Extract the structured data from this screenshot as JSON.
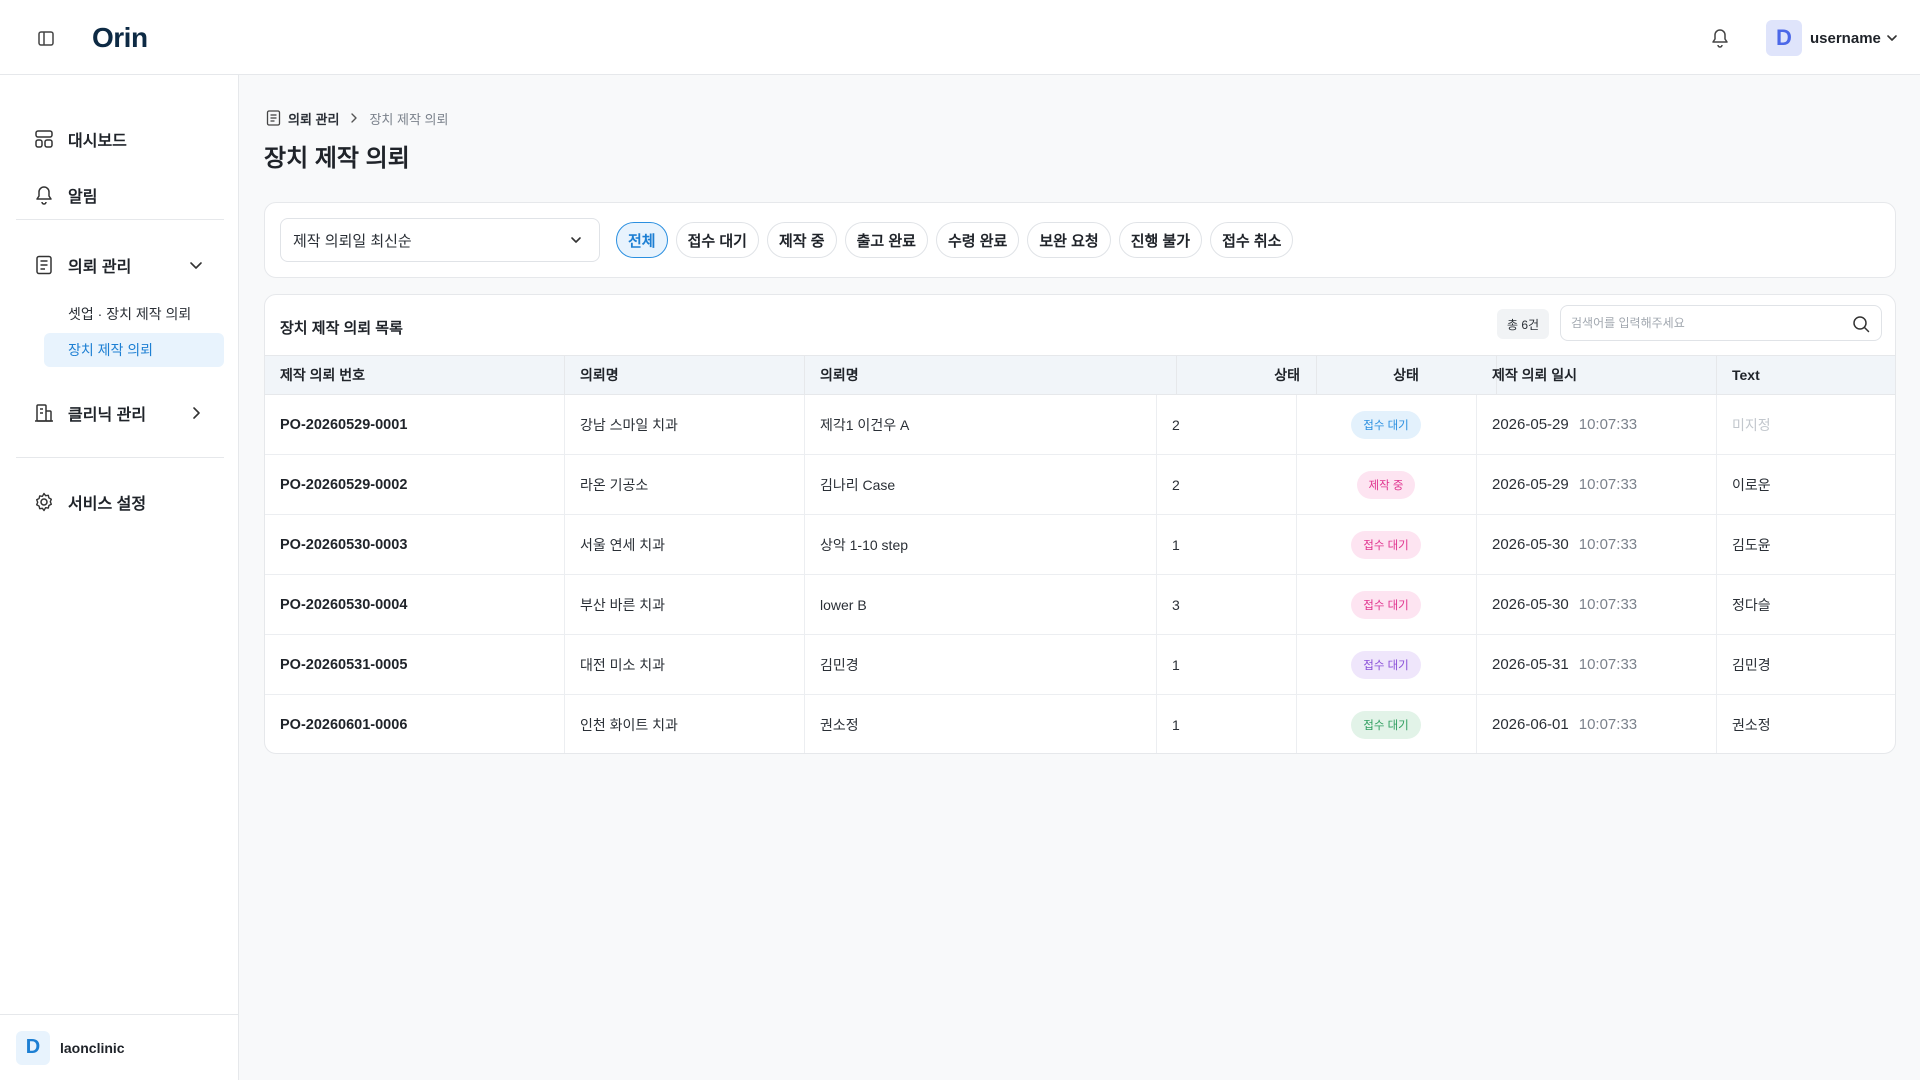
{
  "header": {
    "logo": "Orin",
    "username": "username",
    "avatar_letter": "D"
  },
  "sidebar": {
    "items": [
      {
        "label": "대시보드",
        "icon": "dashboard-icon"
      },
      {
        "label": "알림",
        "icon": "bell-icon"
      },
      {
        "label": "의뢰 관리",
        "icon": "document-list-icon",
        "expanded": true
      },
      {
        "label": "클리닉 관리",
        "icon": "building-icon"
      },
      {
        "label": "서비스 설정",
        "icon": "gear-icon"
      }
    ],
    "sub_items": [
      {
        "label": "셋업 · 장치 제작 의뢰",
        "active": false
      },
      {
        "label": "장치 제작 의뢰",
        "active": true
      }
    ],
    "footer": {
      "avatar_letter": "D",
      "org_name": "laonclinic"
    }
  },
  "breadcrumb": {
    "parent": "의뢰 관리",
    "current": "장치 제작 의뢰"
  },
  "page_title": "장치 제작 의뢰",
  "filters": {
    "sort_value": "제작 의뢰일 최신순",
    "chips": [
      {
        "label": "전체",
        "active": true
      },
      {
        "label": "접수 대기",
        "active": false
      },
      {
        "label": "제작 중",
        "active": false
      },
      {
        "label": "출고 완료",
        "active": false
      },
      {
        "label": "수령 완료",
        "active": false
      },
      {
        "label": "보완 요청",
        "active": false
      },
      {
        "label": "진행 불가",
        "active": false
      },
      {
        "label": "접수 취소",
        "active": false
      }
    ]
  },
  "table": {
    "title": "장치 제작 의뢰 목록",
    "total": "총 6건",
    "search_placeholder": "검색어를 입력해주세요",
    "columns": [
      "제작 의뢰 번호",
      "의뢰명",
      "의뢰명",
      "상태",
      "상태",
      "제작 의뢰 일시",
      "Text"
    ],
    "rows": [
      {
        "order_no": "PO-20260529-0001",
        "clinic": "강남 스마일 치과",
        "request": "제각1 이건우 A",
        "qty": "2",
        "status": "접수 대기",
        "status_color": "#2a8fe0",
        "status_bg": "#e3f1fc",
        "date": "2026-05-29",
        "time": "10:07:33",
        "text": "미지정",
        "text_placeholder": true
      },
      {
        "order_no": "PO-20260529-0002",
        "clinic": "라온 기공소",
        "request": "김나리 Case",
        "qty": "2",
        "status": "제작 중",
        "status_color": "#e0338f",
        "status_bg": "#fde4f1",
        "date": "2026-05-29",
        "time": "10:07:33",
        "text": "이로운",
        "text_placeholder": false
      },
      {
        "order_no": "PO-20260530-0003",
        "clinic": "서울 연세 치과",
        "request": "상악 1-10 step",
        "qty": "1",
        "status": "접수 대기",
        "status_color": "#e0338f",
        "status_bg": "#fde4f1",
        "date": "2026-05-30",
        "time": "10:07:33",
        "text": "김도윤",
        "text_placeholder": false
      },
      {
        "order_no": "PO-20260530-0004",
        "clinic": "부산 바른 치과",
        "request": "lower B",
        "qty": "3",
        "status": "접수 대기",
        "status_color": "#e0338f",
        "status_bg": "#fde4f1",
        "date": "2026-05-30",
        "time": "10:07:33",
        "text": "정다슬",
        "text_placeholder": false
      },
      {
        "order_no": "PO-20260531-0005",
        "clinic": "대전 미소 치과",
        "request": "김민경",
        "qty": "1",
        "status": "접수 대기",
        "status_color": "#8a4fd8",
        "status_bg": "#efe6fb",
        "date": "2026-05-31",
        "time": "10:07:33",
        "text": "김민경",
        "text_placeholder": false
      },
      {
        "order_no": "PO-20260601-0006",
        "clinic": "인천 화이트 치과",
        "request": "권소정",
        "qty": "1",
        "status": "접수 대기",
        "status_color": "#2f9e5f",
        "status_bg": "#e2f3e8",
        "date": "2026-06-01",
        "time": "10:07:33",
        "text": "권소정",
        "text_placeholder": false
      }
    ]
  }
}
